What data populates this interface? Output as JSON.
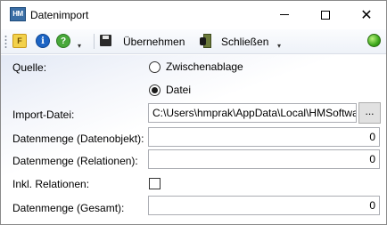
{
  "window": {
    "title": "Datenimport",
    "app_icon": "HM"
  },
  "toolbar": {
    "format_icon": "F",
    "info_icon": "i",
    "help_icon": "?",
    "overflow_glyph": "▾",
    "save_label": "Übernehmen",
    "exit_label": "Schließen",
    "status_color": "#3da81c"
  },
  "form": {
    "source_label": "Quelle:",
    "source_options": [
      {
        "label": "Zwischenablage",
        "selected": false
      },
      {
        "label": "Datei",
        "selected": true
      }
    ],
    "import_file_label": "Import-Datei:",
    "import_file_value": "C:\\Users\\hmprak\\AppData\\Local\\HMSoftwa",
    "browse_label": "...",
    "data_objects_label": "Datenmenge (Datenobjekt):",
    "data_objects_value": "0",
    "relations_label": "Datenmenge (Relationen):",
    "relations_value": "0",
    "include_relations_label": "Inkl. Relationen:",
    "include_relations_checked": false,
    "total_label": "Datenmenge (Gesamt):",
    "total_value": "0"
  }
}
